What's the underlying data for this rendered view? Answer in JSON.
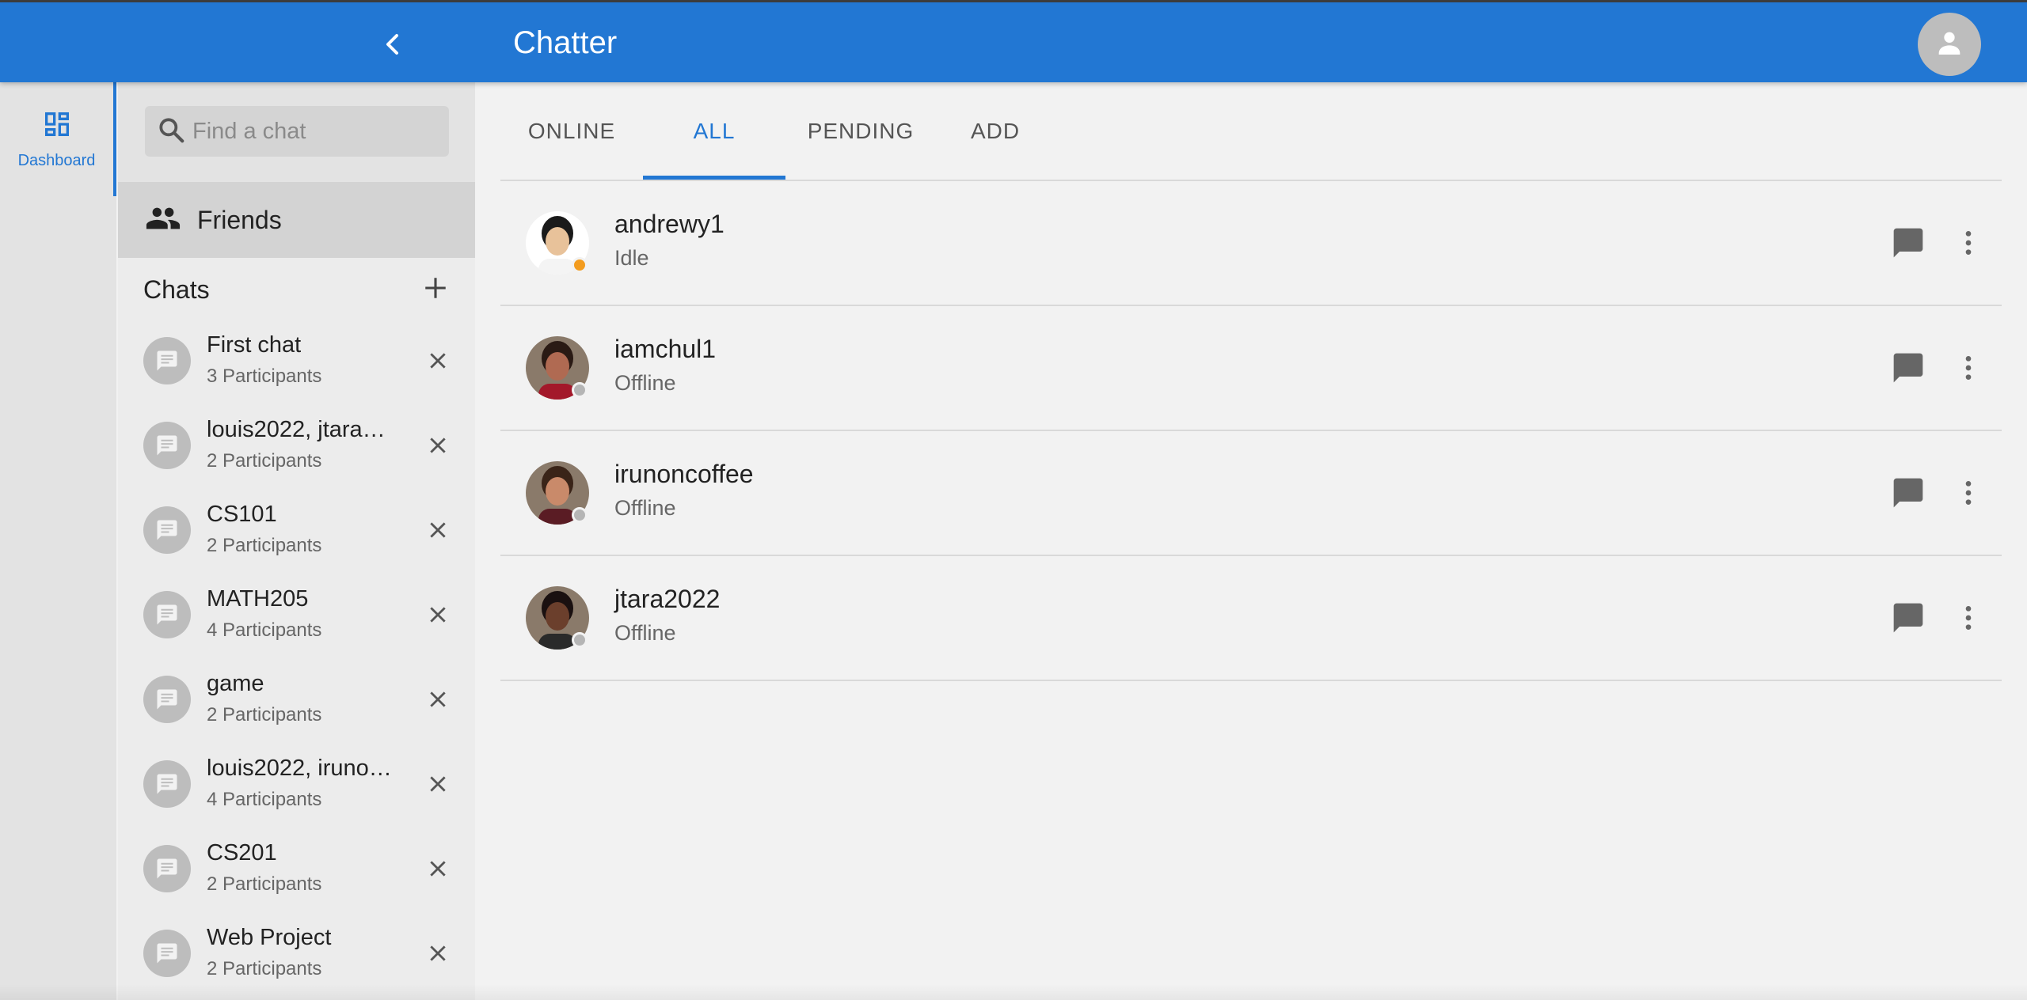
{
  "app": {
    "title": "Chatter"
  },
  "colors": {
    "primary": "#2277d3",
    "idle": "#f39c1f",
    "offline": "#b5b5b5"
  },
  "icons": {
    "collapse": "chevron-left-icon",
    "account": "person-icon",
    "dashboard": "dashboard-icon",
    "search": "search-icon",
    "friends": "people-icon",
    "add_chat": "plus-icon",
    "chat": "message-icon",
    "remove": "close-icon",
    "message": "chat-bubble-icon",
    "more": "more-vert-icon"
  },
  "rail": {
    "dashboard_label": "Dashboard"
  },
  "sidebar": {
    "search_placeholder": "Find a chat",
    "friends_label": "Friends",
    "chats_title": "Chats",
    "chats": [
      {
        "name": "First chat",
        "participants": "3 Participants"
      },
      {
        "name": "louis2022, jtara…",
        "participants": "2 Participants"
      },
      {
        "name": "CS101",
        "participants": "2 Participants"
      },
      {
        "name": "MATH205",
        "participants": "4 Participants"
      },
      {
        "name": "game",
        "participants": "2 Participants"
      },
      {
        "name": "louis2022, iruno…",
        "participants": "4 Participants"
      },
      {
        "name": "CS201",
        "participants": "2 Participants"
      },
      {
        "name": "Web Project",
        "participants": "2 Participants"
      }
    ]
  },
  "tabs": {
    "items": [
      "ONLINE",
      "ALL",
      "PENDING",
      "ADD"
    ],
    "active": "ALL"
  },
  "friends": [
    {
      "username": "andrewy1",
      "status": "Idle"
    },
    {
      "username": "iamchul1",
      "status": "Offline"
    },
    {
      "username": "irunoncoffee",
      "status": "Offline"
    },
    {
      "username": "jtara2022",
      "status": "Offline"
    }
  ]
}
